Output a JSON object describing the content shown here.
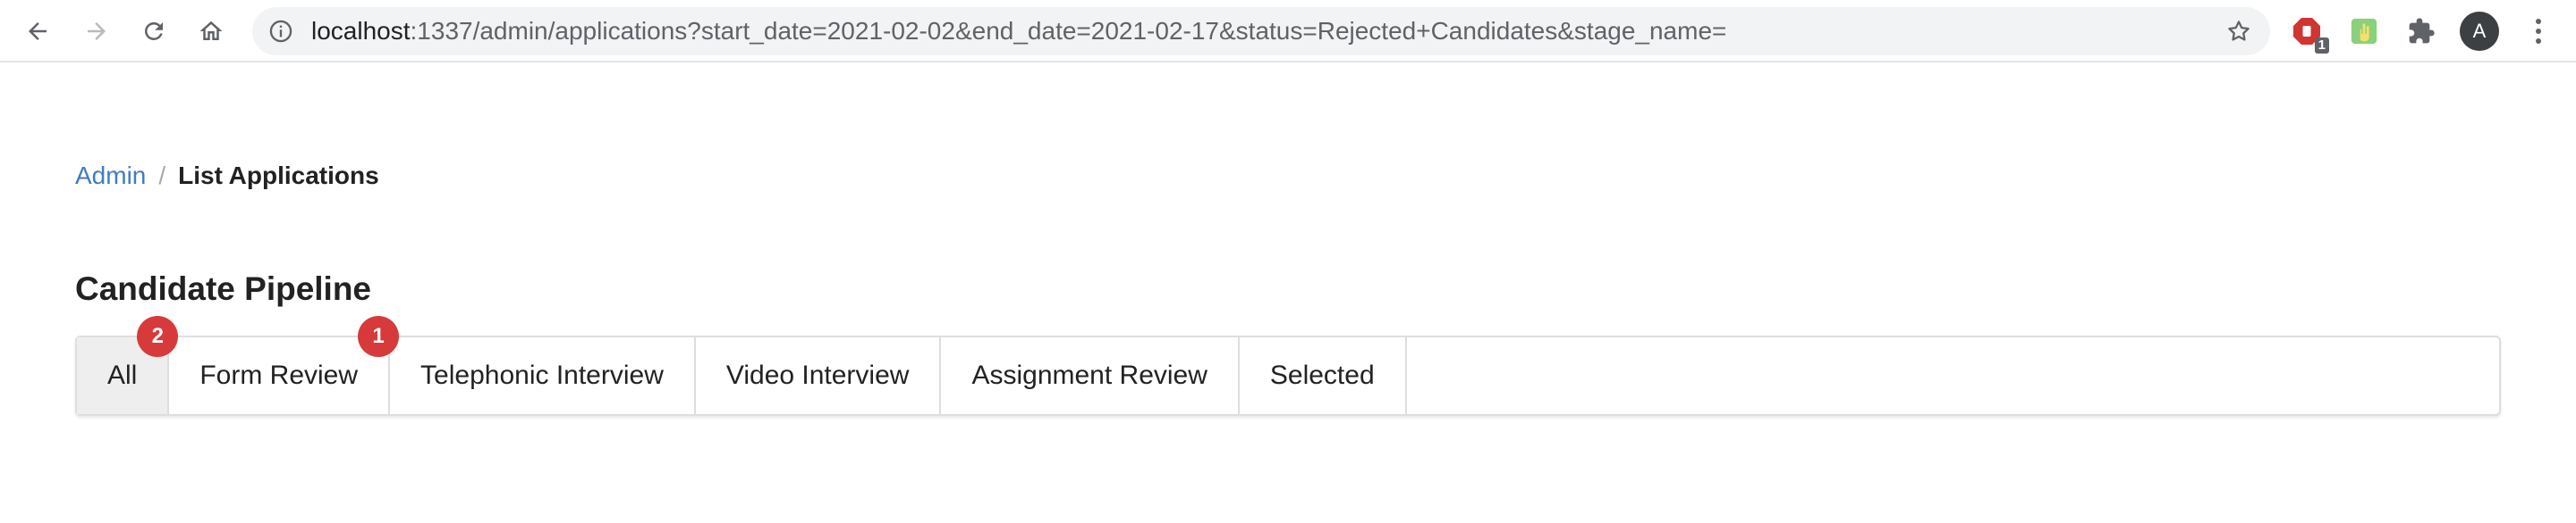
{
  "browser": {
    "url_host": "localhost",
    "url_rest": ":1337/admin/applications?start_date=2021-02-02&end_date=2021-02-17&status=Rejected+Candidates&stage_name=",
    "extension_badge": "1",
    "avatar_letter": "A",
    "icons": [
      "back-icon",
      "forward-icon",
      "reload-icon",
      "home-icon",
      "info-icon",
      "star-icon",
      "puzzle-icon",
      "menu-icon"
    ]
  },
  "breadcrumb": {
    "items": [
      {
        "label": "Admin"
      },
      {
        "label": "List Applications"
      }
    ],
    "separator": "/"
  },
  "page": {
    "title": "Candidate Pipeline"
  },
  "tabs": [
    {
      "label": "All",
      "badge": "2"
    },
    {
      "label": "Form Review",
      "badge": "1"
    },
    {
      "label": "Telephonic Interview",
      "badge": ""
    },
    {
      "label": "Video Interview",
      "badge": ""
    },
    {
      "label": "Assignment Review",
      "badge": ""
    },
    {
      "label": "Selected",
      "badge": ""
    }
  ],
  "colors": {
    "link": "#3f7cc4",
    "badge": "#d73a3a",
    "active_tab_bg": "#eeeeee"
  }
}
